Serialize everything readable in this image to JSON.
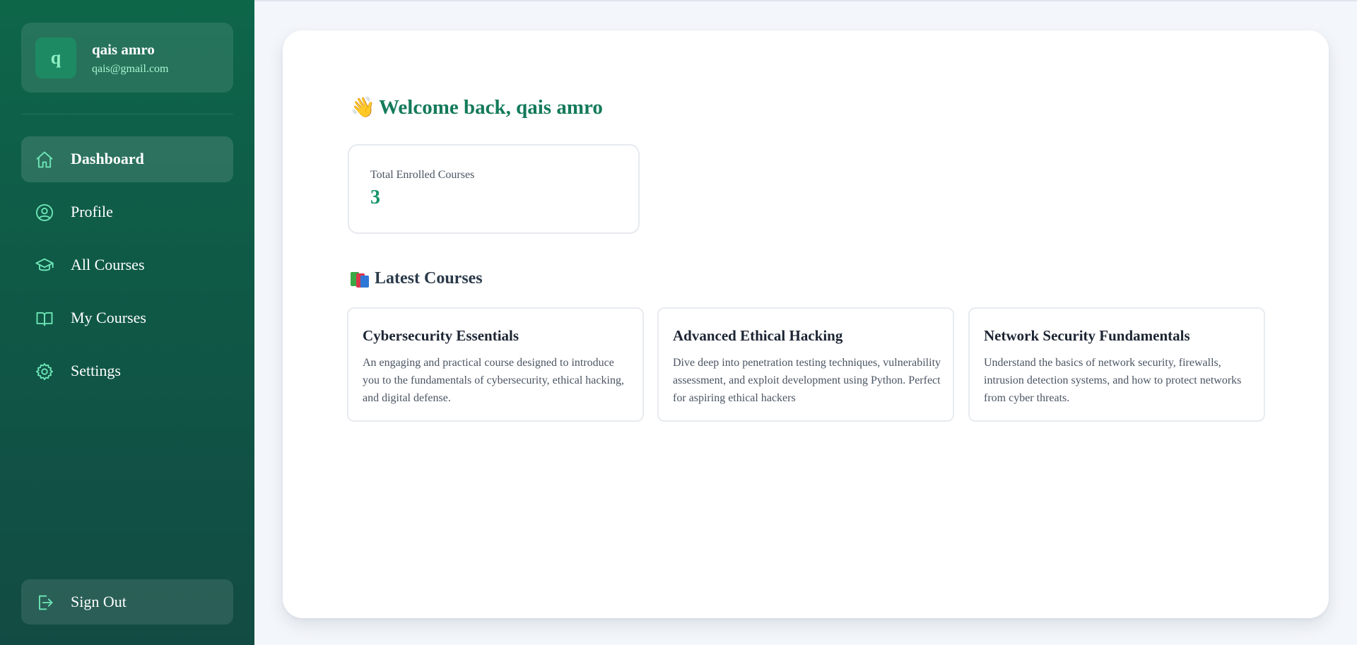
{
  "user": {
    "initial": "q",
    "name": "qais amro",
    "email": "qais@gmail.com"
  },
  "nav": {
    "items": [
      {
        "label": "Dashboard",
        "icon": "home-icon",
        "active": true
      },
      {
        "label": "Profile",
        "icon": "user-circle-icon",
        "active": false
      },
      {
        "label": "All Courses",
        "icon": "graduation-cap-icon",
        "active": false
      },
      {
        "label": "My Courses",
        "icon": "book-open-icon",
        "active": false
      },
      {
        "label": "Settings",
        "icon": "gear-icon",
        "active": false
      }
    ],
    "signout": {
      "label": "Sign Out",
      "icon": "sign-out-icon"
    }
  },
  "main": {
    "welcome_icon": "👋",
    "welcome": "Welcome back, qais amro",
    "stat": {
      "label": "Total Enrolled Courses",
      "value": "3"
    },
    "latest_title": "Latest Courses",
    "courses": [
      {
        "title": "Cybersecurity Essentials",
        "description": "An engaging and practical course designed to introduce you to the fundamentals of cybersecurity, ethical hacking, and digital defense."
      },
      {
        "title": "Advanced Ethical Hacking",
        "description": "Dive deep into penetration testing techniques, vulnerability assessment, and exploit development using Python. Perfect for aspiring ethical hackers"
      },
      {
        "title": "Network Security Fundamentals",
        "description": "Understand the basics of network security, firewalls, intrusion detection systems, and how to protect networks from cyber threats."
      }
    ]
  },
  "colors": {
    "sidebar": "#0f5a47",
    "accent": "#16946b",
    "icon": "#6ee7b7"
  }
}
